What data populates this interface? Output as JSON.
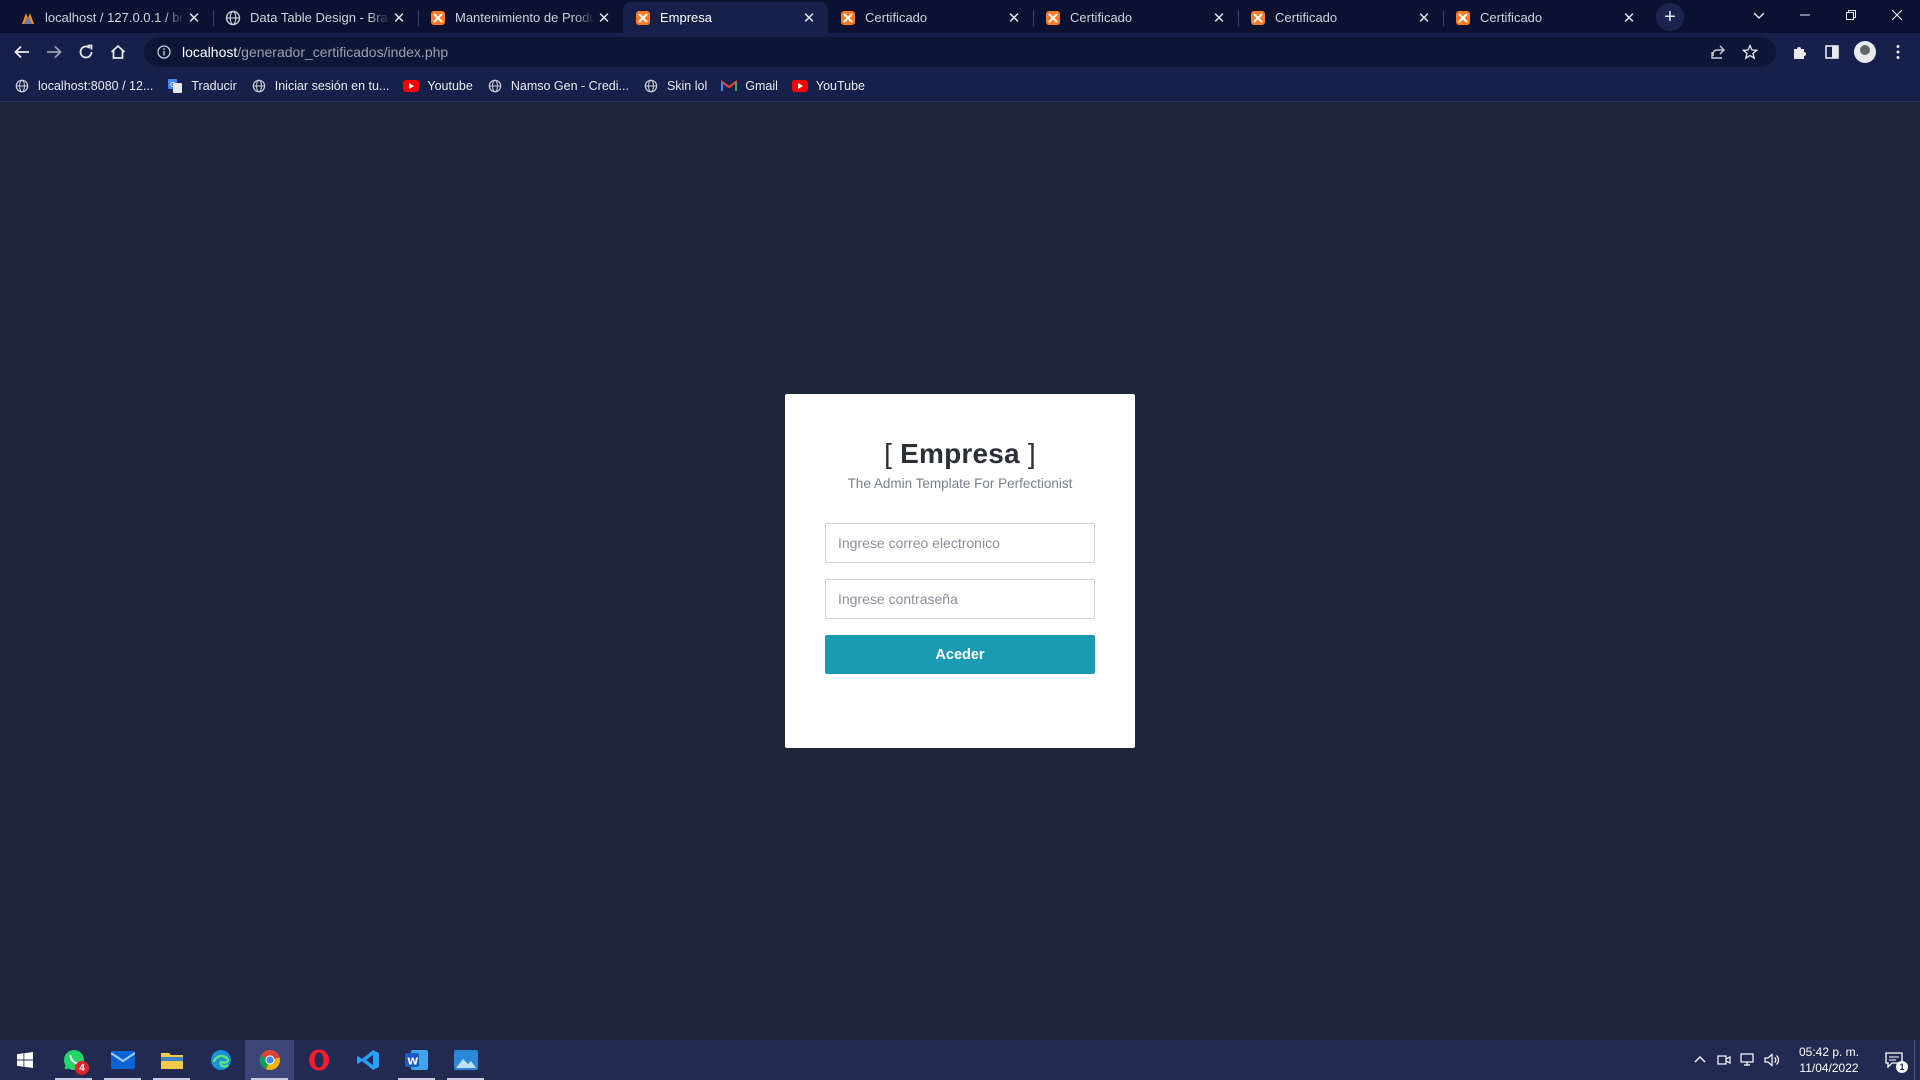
{
  "browser": {
    "tabs": [
      {
        "title": "localhost / 127.0.0.1 / bray",
        "icon": "phpmyadmin-icon"
      },
      {
        "title": "Data Table Design - Bracke",
        "icon": "globe-icon"
      },
      {
        "title": "Mantenimiento de Product",
        "icon": "xampp-icon"
      },
      {
        "title": "Empresa",
        "icon": "xampp-icon",
        "active": true
      },
      {
        "title": "Certificado",
        "icon": "xampp-icon"
      },
      {
        "title": "Certificado",
        "icon": "xampp-icon"
      },
      {
        "title": "Certificado",
        "icon": "xampp-icon"
      },
      {
        "title": "Certificado",
        "icon": "xampp-icon"
      }
    ],
    "address": {
      "host": "localhost",
      "path": "/generador_certificados/index.php"
    },
    "bookmarks": [
      {
        "label": "localhost:8080 / 12...",
        "icon": "globe-icon"
      },
      {
        "label": "Traducir",
        "icon": "translate-icon"
      },
      {
        "label": "Iniciar sesión en tu...",
        "icon": "globe-icon"
      },
      {
        "label": "Youtube",
        "icon": "youtube-icon"
      },
      {
        "label": "Namso Gen - Credi...",
        "icon": "globe-icon"
      },
      {
        "label": "Skin lol",
        "icon": "globe-icon"
      },
      {
        "label": "Gmail",
        "icon": "gmail-icon"
      },
      {
        "label": "YouTube",
        "icon": "youtube-icon"
      }
    ]
  },
  "login": {
    "brand_open": "[",
    "brand": "Empresa",
    "brand_close": "]",
    "tagline": "The Admin Template For Perfectionist",
    "email_placeholder": "Ingrese correo electronico",
    "password_placeholder": "Ingrese contraseña",
    "submit_label": "Aceder"
  },
  "taskbar": {
    "apps": [
      "whatsapp",
      "mail",
      "file-explorer",
      "edge",
      "chrome",
      "opera",
      "vscode",
      "word",
      "photos"
    ],
    "whatsapp_badge": "4",
    "clock_time": "05:42 p. m.",
    "clock_date": "11/04/2022",
    "notification_count": "1"
  },
  "colors": {
    "page_bg": "#1e2738",
    "chrome_dark": "#0b1130",
    "chrome_toolbar": "#16204a",
    "accent_button": "#1b9bb3",
    "taskbar": "#232a52"
  }
}
